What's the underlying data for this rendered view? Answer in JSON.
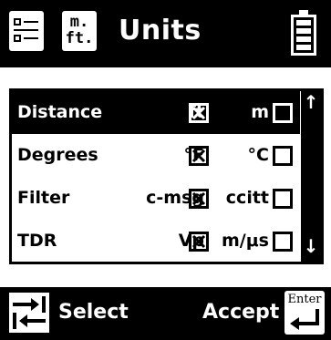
{
  "header": {
    "title": "Units",
    "units_icon_line1": "m.",
    "units_icon_line2": "ft.",
    "left_icon": "menu-list-icon",
    "right_icon": "battery-icon"
  },
  "rows": [
    {
      "label": "Distance",
      "option1": "ft",
      "option1_checked": true,
      "option2": "m",
      "option2_checked": false,
      "selected": true
    },
    {
      "label": "Degrees",
      "option1": "°F",
      "option1_checked": true,
      "option2": "°C",
      "option2_checked": false,
      "selected": false
    },
    {
      "label": "Filter",
      "option1": "c-msg",
      "option1_checked": true,
      "option2": "ccitt",
      "option2_checked": false,
      "selected": false
    },
    {
      "label": "TDR",
      "option1": "Vp",
      "option1_checked": true,
      "option2": "m/μs",
      "option2_checked": false,
      "selected": false
    }
  ],
  "scrollbar": {
    "up_arrow": "↑",
    "down_arrow": "↓"
  },
  "footer": {
    "select_label": "Select",
    "accept_label": "Accept",
    "enter_icon_text": "Enter",
    "left_icon": "tab-arrows-icon"
  },
  "colors": {
    "background": "#ffffff",
    "bar": "#000000"
  }
}
